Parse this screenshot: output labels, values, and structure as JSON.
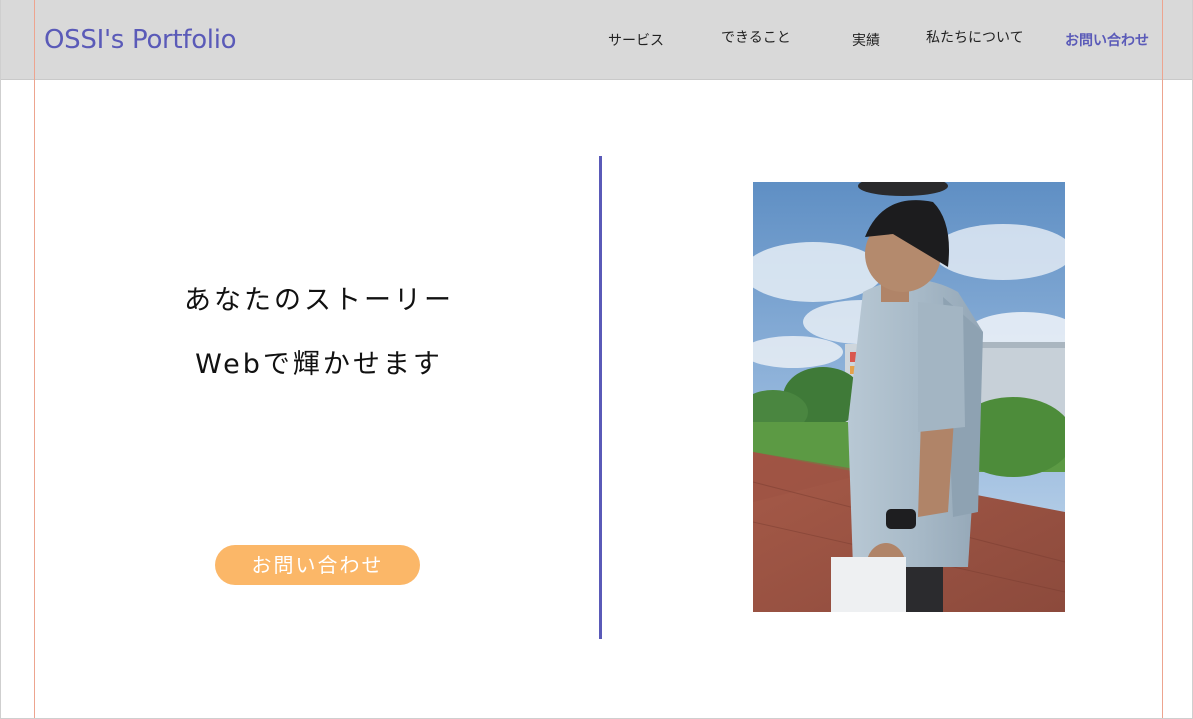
{
  "header": {
    "logo": "OSSI's Portfolio",
    "nav": {
      "services": "サービス",
      "skills": "できること",
      "works": "実績",
      "about": "私たちについて",
      "contact": "お問い合わせ"
    }
  },
  "hero": {
    "line1": "あなたのストーリー",
    "line2": "Webで輝かせます",
    "cta_label": "お問い合わせ"
  },
  "colors": {
    "accent": "#5a5ab8",
    "cta": "#fbb768",
    "header_bg": "#d9d9d9",
    "guide": "#eda48f"
  }
}
